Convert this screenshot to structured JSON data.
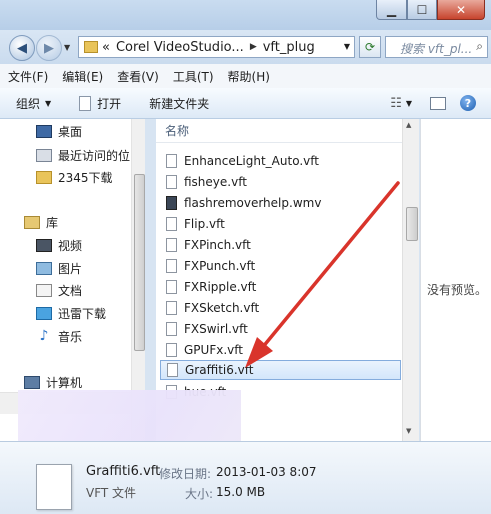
{
  "address": {
    "prefix": "«",
    "segments": [
      "Corel VideoStudio...",
      "vft_plug"
    ]
  },
  "search": {
    "placeholder": "搜索 vft_pl..."
  },
  "menu": [
    "文件(F)",
    "编辑(E)",
    "查看(V)",
    "工具(T)",
    "帮助(H)"
  ],
  "toolbar": {
    "organize": "组织",
    "open": "打开",
    "new_folder": "新建文件夹"
  },
  "nav": {
    "favorites": [
      {
        "label": "桌面",
        "icon": "desktop-icon"
      },
      {
        "label": "最近访问的位",
        "icon": "recent-places-icon"
      },
      {
        "label": "2345下载",
        "icon": "folder-icon"
      }
    ],
    "library_header": "库",
    "libraries": [
      {
        "label": "视频",
        "icon": "video-library-icon"
      },
      {
        "label": "图片",
        "icon": "pictures-library-icon"
      },
      {
        "label": "文档",
        "icon": "documents-library-icon"
      },
      {
        "label": "迅雷下载",
        "icon": "thunder-download-icon"
      },
      {
        "label": "音乐",
        "icon": "music-library-icon"
      }
    ],
    "computer": "计算机"
  },
  "filelist": {
    "column_name": "名称",
    "files": [
      "EnhanceLight_Auto.vft",
      "fisheye.vft",
      "flashremoverhelp.wmv",
      "Flip.vft",
      "FXPinch.vft",
      "FXPunch.vft",
      "FXRipple.vft",
      "FXSketch.vft",
      "FXSwirl.vft",
      "GPUFx.vft",
      "Graffiti6.vft",
      "hue.vft"
    ],
    "selected_index": 10
  },
  "preview": {
    "text": "没有预览。"
  },
  "details": {
    "name": "Graffiti6.vft",
    "type": "VFT 文件",
    "modified_label": "修改日期:",
    "modified_value": "2013-01-03 8:07",
    "size_label": "大小:",
    "size_value": "15.0 MB"
  },
  "colors": {
    "annotation_arrow": "#d9342b",
    "selection_border": "#84acdd"
  }
}
